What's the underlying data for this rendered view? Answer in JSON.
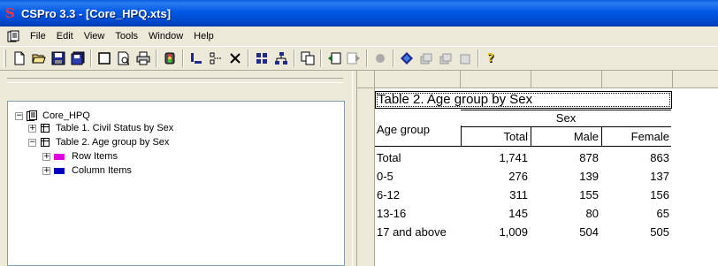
{
  "window": {
    "title": "CSPro 3.3 - [Core_HPQ.xts]"
  },
  "menu": [
    "File",
    "Edit",
    "View",
    "Tools",
    "Window",
    "Help"
  ],
  "toolbar": [
    "new-icon",
    "open-icon",
    "save-icon",
    "save-all-icon",
    "page-icon",
    "print-preview-icon",
    "print-icon",
    "run-icon",
    "area-icon",
    "page-break-icon",
    "delete-icon",
    "grid-icon",
    "tree-icon",
    "copy-icon",
    "back-icon",
    "forward-icon",
    "record-icon",
    "dictionary-icon",
    "stack-icon",
    "stack2-icon",
    "stack3-icon",
    "help-icon"
  ],
  "tree": {
    "root": "Core_HPQ",
    "items": [
      {
        "label": "Table 1. Civil Status by Sex",
        "expander": "+"
      },
      {
        "label": "Table 2. Age group by Sex",
        "expander": "−"
      },
      {
        "label": "Row Items",
        "expander": "+",
        "color": "#E000E0"
      },
      {
        "label": "Column Items",
        "expander": "+",
        "color": "#0000C0"
      }
    ]
  },
  "table": {
    "title": "Table 2. Age group by Sex",
    "stub_header": "Age group",
    "spanner": "Sex",
    "columns": [
      "Total",
      "Male",
      "Female"
    ],
    "rows": [
      {
        "label": "Total",
        "values": [
          "1,741",
          "878",
          "863"
        ]
      },
      {
        "label": "0-5",
        "values": [
          "276",
          "139",
          "137"
        ]
      },
      {
        "label": "6-12",
        "values": [
          "311",
          "155",
          "156"
        ]
      },
      {
        "label": "13-16",
        "values": [
          "145",
          "80",
          "65"
        ]
      },
      {
        "label": "17 and above",
        "values": [
          "1,009",
          "504",
          "505"
        ]
      }
    ]
  }
}
